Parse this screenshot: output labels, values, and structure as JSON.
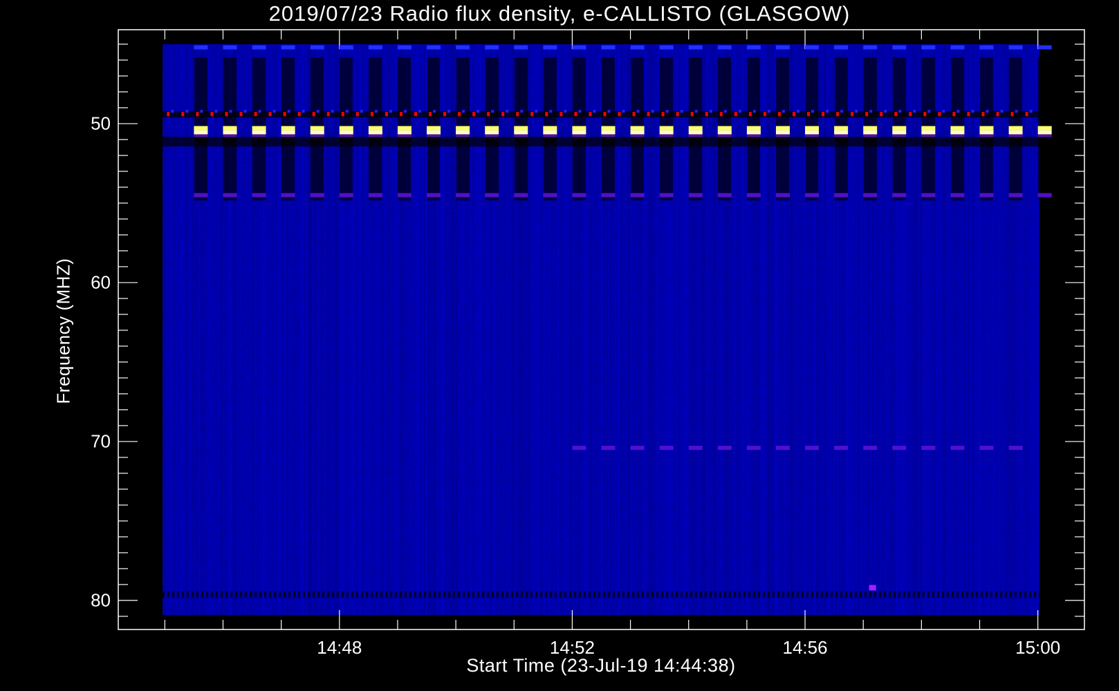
{
  "chart_data": {
    "type": "heatmap",
    "title": "2019/07/23  Radio flux density, e-CALLISTO (GLASGOW)",
    "xlabel": "Start Time (23-Jul-19 14:44:38)",
    "ylabel": "Frequency (MHZ)",
    "x_unit": "minutes after 14:00 UT",
    "xlim": [
      44.2,
      60.8
    ],
    "data_xrange": [
      45.0,
      60.0
    ],
    "ylim": [
      81.83,
      44.09
    ],
    "data_yrange": [
      45.0,
      80.9
    ],
    "x_major_ticks": [
      {
        "value": 48,
        "label": "14:48"
      },
      {
        "value": 52,
        "label": "14:52"
      },
      {
        "value": 56,
        "label": "14:56"
      },
      {
        "value": 60,
        "label": "15:00"
      }
    ],
    "x_minor_tick_step": 1,
    "y_major_ticks": [
      {
        "value": 50,
        "label": "50"
      },
      {
        "value": 60,
        "label": "60"
      },
      {
        "value": 70,
        "label": "70"
      },
      {
        "value": 80,
        "label": "80"
      }
    ],
    "y_minor_tick_step": 1,
    "y_inverted": true,
    "grid": false,
    "colormap": [
      "#000000",
      "#0000a0",
      "#1010e0",
      "#6000c0",
      "#ff0000",
      "#ffff60",
      "#ffffe0"
    ],
    "background_level_color": "#0a0aa8",
    "features": [
      {
        "name": "periodic-bright-pulses",
        "freq_mhz": 50.5,
        "period_min": 0.5,
        "start_min": 45.5,
        "count": 30,
        "color": "#ffffc0"
      },
      {
        "name": "periodic-red-interference",
        "freq_mhz": 49.4,
        "period_min": 0.25,
        "start_min": 45.0,
        "count": 60,
        "color": "#ff0000"
      },
      {
        "name": "periodic-purple-pulses",
        "freq_mhz": 54.5,
        "period_min": 0.5,
        "start_min": 45.5,
        "count": 30,
        "color": "#5010c8"
      },
      {
        "name": "top-blue-pulses",
        "freq_mhz": 45.2,
        "period_min": 0.5,
        "start_min": 45.5,
        "count": 30,
        "color": "#2030ff"
      },
      {
        "name": "purple-dashes-70mhz",
        "freq_mhz": 70.4,
        "period_min": 0.5,
        "start_min": 52.0,
        "count": 16,
        "color": "#5010d0"
      },
      {
        "name": "dark-dotted-line-80mhz",
        "freq_mhz": 79.6,
        "color": "#000040"
      },
      {
        "name": "magenta-burst",
        "freq_mhz": 79.2,
        "time_min": 57.1,
        "color": "#a020ff"
      }
    ]
  }
}
